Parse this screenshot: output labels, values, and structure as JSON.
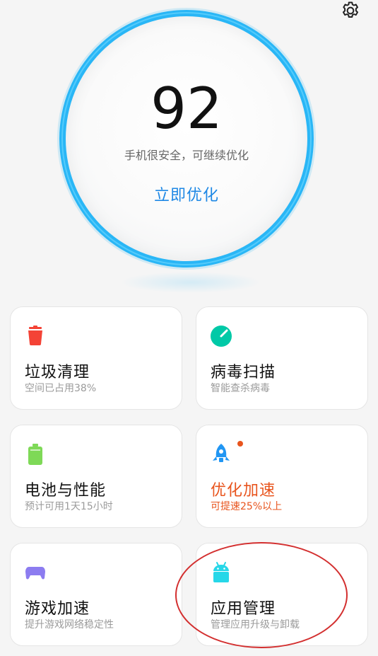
{
  "header": {
    "settings_icon": "gear-icon"
  },
  "hero": {
    "score": "92",
    "status": "手机很安全，可继续优化",
    "action_label": "立即优化",
    "ring_color": "#29b6f6",
    "action_color": "#1e88e5"
  },
  "cards": [
    {
      "title": "垃圾清理",
      "subtitle": "空间已占用38%",
      "icon": "trash-can-icon",
      "icon_color": "#f44336"
    },
    {
      "title": "病毒扫描",
      "subtitle": "智能查杀病毒",
      "icon": "scan-radar-icon",
      "icon_color": "#00c9a7"
    },
    {
      "title": "电池与性能",
      "subtitle": "预计可用1天15小时",
      "icon": "battery-icon",
      "icon_color": "#7ed957"
    },
    {
      "title": "优化加速",
      "subtitle": "可提速25%以上",
      "icon": "rocket-icon",
      "icon_color": "#2196f3",
      "accent_color": "#e8541d",
      "has_badge": true
    },
    {
      "title": "游戏加速",
      "subtitle": "提升游戏网络稳定性",
      "icon": "gamepad-icon",
      "icon_color": "#8c7cf0"
    },
    {
      "title": "应用管理",
      "subtitle": "管理应用升级与卸载",
      "icon": "android-icon",
      "icon_color": "#26d7e8"
    }
  ],
  "annotation": {
    "highlight_color": "#d32f2f",
    "highlight_target": "应用管理"
  }
}
